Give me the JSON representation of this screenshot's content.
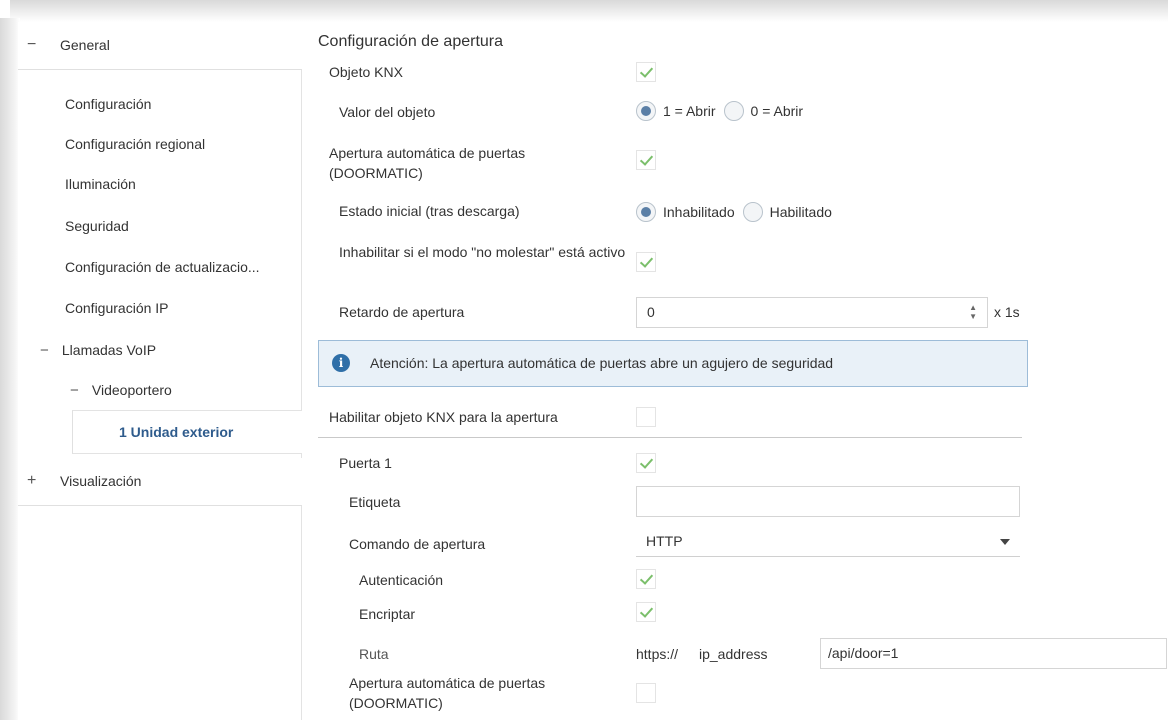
{
  "sidebar": {
    "general": {
      "toggle": "−",
      "label": "General"
    },
    "items": [
      {
        "label": "Configuración"
      },
      {
        "label": "Configuración regional"
      },
      {
        "label": "Iluminación"
      },
      {
        "label": "Seguridad"
      },
      {
        "label": "Configuración de actualizacio..."
      },
      {
        "label": "Configuración IP"
      }
    ],
    "voip": {
      "toggle": "−",
      "label": "Llamadas VoIP"
    },
    "videoportero": {
      "toggle": "−",
      "label": "Videoportero"
    },
    "selected": {
      "label": "1 Unidad exterior"
    },
    "visualizacion": {
      "toggle": "+",
      "label": "Visualización"
    }
  },
  "main": {
    "section_title": "Configuración de apertura",
    "objeto_knx": {
      "label": "Objeto KNX",
      "checked": true
    },
    "valor_objeto": {
      "label": "Valor del objeto",
      "options": [
        {
          "label": "1 = Abrir",
          "selected": true
        },
        {
          "label": "0 = Abrir",
          "selected": false
        }
      ]
    },
    "doormatic": {
      "label": "Apertura automática de puertas (DOORMATIC)",
      "checked": true
    },
    "estado_inicial": {
      "label": "Estado inicial (tras descarga)",
      "options": [
        {
          "label": "Inhabilitado",
          "selected": true
        },
        {
          "label": "Habilitado",
          "selected": false
        }
      ]
    },
    "no_molestar": {
      "label": "Inhabilitar si el modo \"no molestar\" está activo",
      "checked": true
    },
    "retardo": {
      "label": "Retardo de apertura",
      "value": "0",
      "unit": "x 1s"
    },
    "info": {
      "icon": "info-icon",
      "text": "Atención: La apertura automática de puertas abre un agujero de seguridad"
    },
    "habilitar_knx": {
      "label": "Habilitar objeto KNX para la apertura",
      "checked": false
    },
    "puerta1": {
      "label": "Puerta 1",
      "checked": true
    },
    "etiqueta": {
      "label": "Etiqueta",
      "value": ""
    },
    "comando": {
      "label": "Comando de apertura",
      "value": "HTTP"
    },
    "autenticacion": {
      "label": "Autenticación",
      "checked": true
    },
    "encriptar": {
      "label": "Encriptar",
      "checked": true
    },
    "ruta": {
      "label": "Ruta",
      "prefix": "https://",
      "host": "ip_address",
      "value": "/api/door=1"
    },
    "doormatic2": {
      "label": "Apertura automática de puertas (DOORMATIC)",
      "checked": false
    }
  },
  "colors": {
    "accent": "#2e5b8c",
    "check": "#7bbf6b",
    "info_bg": "#e9f1f8",
    "info_border": "#9dbcd8"
  }
}
